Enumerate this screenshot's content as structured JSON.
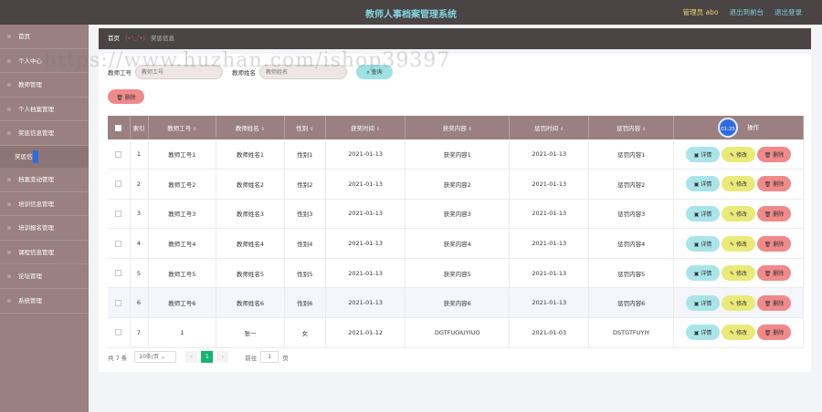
{
  "header": {
    "title": "教师人事档案管理系统",
    "admin": "管理员 abo",
    "back_home": "退出到前台",
    "logout": "退出登录"
  },
  "sidebar": {
    "items": [
      {
        "label": "首页"
      },
      {
        "label": "个人中心"
      },
      {
        "label": "教师管理"
      },
      {
        "label": "个人档案管理"
      },
      {
        "label": "奖惩信息管理"
      }
    ],
    "submenu": [
      "奖惩信息"
    ],
    "items_after": [
      {
        "label": "档案变动管理"
      },
      {
        "label": "培训信息管理"
      },
      {
        "label": "培训报名管理"
      },
      {
        "label": "课程信息管理"
      },
      {
        "label": "论坛管理"
      },
      {
        "label": "系统管理"
      }
    ]
  },
  "breadcrumb": {
    "home": "首页",
    "emoticon": "(•'◡'•)",
    "current": "奖惩信息"
  },
  "search": {
    "label1": "教师工号",
    "placeholder1": "教师工号",
    "label2": "教师姓名",
    "placeholder2": "教师姓名",
    "query": "查询"
  },
  "batch_delete": "删除",
  "table": {
    "headers": [
      "索引",
      "教师工号",
      "教师姓名",
      "性别",
      "获奖时间",
      "获奖内容",
      "惩罚时间",
      "惩罚内容",
      "操作"
    ],
    "clock": "01:25",
    "actions": {
      "detail": "详情",
      "edit": "修改",
      "delete": "删除"
    },
    "rows": [
      [
        "1",
        "教师工号1",
        "教师姓名1",
        "性别1",
        "2021-01-13",
        "获奖内容1",
        "2021-01-13",
        "惩罚内容1"
      ],
      [
        "2",
        "教师工号2",
        "教师姓名2",
        "性别2",
        "2021-01-13",
        "获奖内容2",
        "2021-01-13",
        "惩罚内容2"
      ],
      [
        "3",
        "教师工号3",
        "教师姓名3",
        "性别3",
        "2021-01-13",
        "获奖内容3",
        "2021-01-13",
        "惩罚内容3"
      ],
      [
        "4",
        "教师工号4",
        "教师姓名4",
        "性别4",
        "2021-01-13",
        "获奖内容4",
        "2021-01-13",
        "惩罚内容4"
      ],
      [
        "5",
        "教师工号5",
        "教师姓名5",
        "性别5",
        "2021-01-13",
        "获奖内容5",
        "2021-01-13",
        "惩罚内容5"
      ],
      [
        "6",
        "教师工号6",
        "教师姓名6",
        "性别6",
        "2021-01-13",
        "获奖内容6",
        "2021-01-13",
        "惩罚内容6"
      ],
      [
        "7",
        "1",
        "张一",
        "女",
        "2021-01-12",
        "DGTFUGIUYIUO",
        "2021-01-03",
        "DSTGTFUYIY"
      ]
    ]
  },
  "pagination": {
    "total": "共 7 条",
    "page_size": "10条/页",
    "prev": "‹",
    "current": "1",
    "next": "›",
    "goto": "前往",
    "goto_value": "1",
    "page_unit": "页"
  },
  "watermark": "https://www.huzhan.com/ishop39397"
}
